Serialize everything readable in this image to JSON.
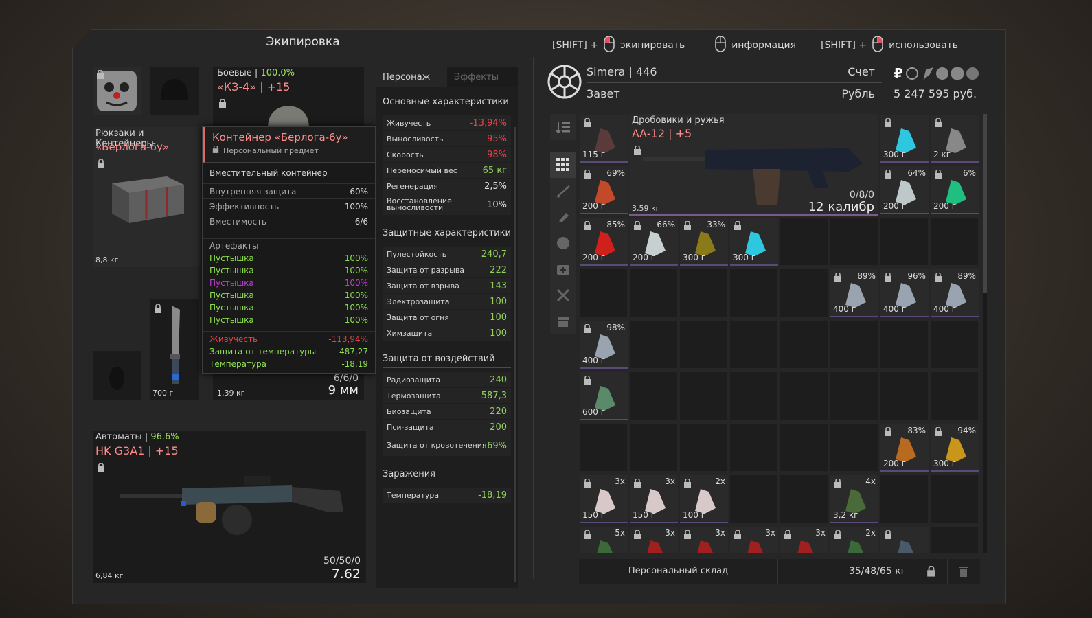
{
  "equipment_title": "Экипировка",
  "hints": {
    "shift1": "[SHIFT] +",
    "equip": "экипировать",
    "info": "информация",
    "shift2": "[SHIFT] +",
    "use": "использовать"
  },
  "profile": {
    "name": "Simera | 446",
    "faction": "Завет",
    "account_label": "Счет",
    "currency": "Рубль",
    "money": "5 247 595 руб."
  },
  "armor": {
    "category": "Боевые",
    "durability": "100.0%",
    "name": "«КЗ-4» | +15"
  },
  "container": {
    "category": "Рюкзаки и Контейнеры",
    "name": "«Берлога-6у»",
    "weight": "8,8 кг"
  },
  "tooltip": {
    "title": "Контейнер «Берлога-6у»",
    "personal": "Персональный предмет",
    "desc": "Вместительный контейнер",
    "props": [
      {
        "k": "Внутренняя защита",
        "v": "60%"
      },
      {
        "k": "Эффективность",
        "v": "100%"
      },
      {
        "k": "Вместимость",
        "v": "6/6"
      }
    ],
    "art_title": "Артефакты",
    "artifacts": [
      {
        "n": "Пустышка",
        "v": "100%",
        "c": "#8fe04f"
      },
      {
        "n": "Пустышка",
        "v": "100%",
        "c": "#8fe04f"
      },
      {
        "n": "Пустышка",
        "v": "100%",
        "c": "#c23bd6"
      },
      {
        "n": "Пустышка",
        "v": "100%",
        "c": "#8fe04f"
      },
      {
        "n": "Пустышка",
        "v": "100%",
        "c": "#8fe04f"
      },
      {
        "n": "Пустышка",
        "v": "100%",
        "c": "#8fe04f"
      }
    ],
    "effects": [
      {
        "n": "Живучесть",
        "v": "-113,94%",
        "c": "#e0444a"
      },
      {
        "n": "Защита от температуры",
        "v": "487,27",
        "c": "#8fe04f"
      },
      {
        "n": "Температура",
        "v": "-18,19",
        "c": "#8fe04f"
      }
    ]
  },
  "knife": {
    "weight": "700 г"
  },
  "pistol": {
    "ammo": "6/6/0",
    "caliber": "9 мм",
    "weight": "1,39 кг"
  },
  "rifle": {
    "category": "Автоматы",
    "durability": "96.6%",
    "name": "HK G3A1 | +15",
    "ammo": "50/50/0",
    "caliber": "7.62",
    "weight": "6,84 кг"
  },
  "tabs": {
    "character": "Персонаж",
    "effects": "Эффекты"
  },
  "stats": {
    "main_title": "Основные характеристики",
    "main": [
      {
        "k": "Живучесть",
        "v": "-13,94%",
        "c": "#e0444a"
      },
      {
        "k": "Выносливость",
        "v": "95%",
        "c": "#e0444a"
      },
      {
        "k": "Скорость",
        "v": "98%",
        "c": "#e0444a"
      },
      {
        "k": "Переносимый вес",
        "v": "65 кг",
        "c": "#8fd25a"
      },
      {
        "k": "Регенерация",
        "v": "2,5%",
        "c": "#e0e0e0"
      },
      {
        "k": "Восстановление выносливости",
        "v": "10%",
        "c": "#e0e0e0"
      }
    ],
    "prot_title": "Защитные характеристики",
    "prot": [
      {
        "k": "Пулестойкость",
        "v": "240,7"
      },
      {
        "k": "Защита от разрыва",
        "v": "222"
      },
      {
        "k": "Защита от взрыва",
        "v": "143"
      },
      {
        "k": "Электрозащита",
        "v": "100"
      },
      {
        "k": "Защита от огня",
        "v": "100"
      },
      {
        "k": "Химзащита",
        "v": "100"
      }
    ],
    "imp_title": "Защита от воздействий",
    "imp": [
      {
        "k": "Радиозащита",
        "v": "240"
      },
      {
        "k": "Термозащита",
        "v": "587,3"
      },
      {
        "k": "Биозащита",
        "v": "220"
      },
      {
        "k": "Пси-защита",
        "v": "200"
      },
      {
        "k": "Защита от кровотечения",
        "v": "69%"
      }
    ],
    "inf_title": "Заражения",
    "inf": [
      {
        "k": "Температура",
        "v": "-18,19"
      }
    ]
  },
  "shotgun": {
    "category": "Дробовики и ружья",
    "name": "АА-12 | +5",
    "weight": "3,59 кг",
    "ammo": "0/8/0",
    "caliber": "12 калибр"
  },
  "items": [
    {
      "c": 0,
      "r": 0,
      "w": "115 г",
      "p": "",
      "n": "",
      "col": "#5a3a3a"
    },
    {
      "c": 6,
      "r": 0,
      "w": "300 г",
      "p": "",
      "n": "",
      "col": "#2ec7e0"
    },
    {
      "c": 7,
      "r": 0,
      "w": "2 кг",
      "p": "",
      "n": "",
      "col": "#888"
    },
    {
      "c": 0,
      "r": 1,
      "w": "200 г",
      "p": "69%",
      "n": "",
      "col": "#c24a2a"
    },
    {
      "c": 6,
      "r": 1,
      "w": "200 г",
      "p": "64%",
      "n": "",
      "col": "#bfc8c8"
    },
    {
      "c": 7,
      "r": 1,
      "w": "200 г",
      "p": "6%",
      "n": "",
      "col": "#1fbf80"
    },
    {
      "c": 0,
      "r": 2,
      "w": "200 г",
      "p": "85%",
      "n": "",
      "col": "#d0201c"
    },
    {
      "c": 1,
      "r": 2,
      "w": "200 г",
      "p": "66%",
      "n": "",
      "col": "#c8cfd0"
    },
    {
      "c": 2,
      "r": 2,
      "w": "300 г",
      "p": "33%",
      "n": "",
      "col": "#8a7a1a"
    },
    {
      "c": 3,
      "r": 2,
      "w": "300 г",
      "p": "",
      "n": "",
      "col": "#2ec7e0"
    },
    {
      "c": 5,
      "r": 3,
      "w": "400 г",
      "p": "89%",
      "n": "",
      "col": "#9aa4b0"
    },
    {
      "c": 6,
      "r": 3,
      "w": "400 г",
      "p": "96%",
      "n": "",
      "col": "#9aa4b0"
    },
    {
      "c": 7,
      "r": 3,
      "w": "400 г",
      "p": "89%",
      "n": "",
      "col": "#9aa4b0"
    },
    {
      "c": 0,
      "r": 4,
      "w": "400 г",
      "p": "98%",
      "n": "",
      "col": "#9aa4b0"
    },
    {
      "c": 0,
      "r": 5,
      "w": "600 г",
      "p": "",
      "n": "",
      "col": "#5a8a6a"
    },
    {
      "c": 6,
      "r": 6,
      "w": "200 г",
      "p": "83%",
      "n": "",
      "col": "#b86a20"
    },
    {
      "c": 7,
      "r": 6,
      "w": "300 г",
      "p": "94%",
      "n": "",
      "col": "#c8961a"
    },
    {
      "c": 0,
      "r": 7,
      "w": "150 г",
      "p": "",
      "n": "3x",
      "col": "#d8c8c8"
    },
    {
      "c": 1,
      "r": 7,
      "w": "150 г",
      "p": "",
      "n": "3x",
      "col": "#d8c8c8"
    },
    {
      "c": 2,
      "r": 7,
      "w": "100 г",
      "p": "",
      "n": "2x",
      "col": "#d8c8c8"
    },
    {
      "c": 5,
      "r": 7,
      "w": "3,2 кг",
      "p": "",
      "n": "4x",
      "col": "#4a6a3a"
    },
    {
      "c": 0,
      "r": 8,
      "w": "",
      "p": "",
      "n": "5x",
      "col": "#3a6a3a"
    },
    {
      "c": 1,
      "r": 8,
      "w": "",
      "p": "",
      "n": "3x",
      "col": "#a02020"
    },
    {
      "c": 2,
      "r": 8,
      "w": "",
      "p": "",
      "n": "3x",
      "col": "#a02020"
    },
    {
      "c": 3,
      "r": 8,
      "w": "",
      "p": "",
      "n": "3x",
      "col": "#a02020"
    },
    {
      "c": 4,
      "r": 8,
      "w": "",
      "p": "",
      "n": "3x",
      "col": "#a02020"
    },
    {
      "c": 5,
      "r": 8,
      "w": "",
      "p": "",
      "n": "2x",
      "col": "#3a6a3a"
    },
    {
      "c": 6,
      "r": 8,
      "w": "",
      "p": "",
      "n": "",
      "col": "#4a5a6a"
    }
  ],
  "footer": {
    "storage": "Персональный склад",
    "weight": "35/48/65 кг"
  }
}
